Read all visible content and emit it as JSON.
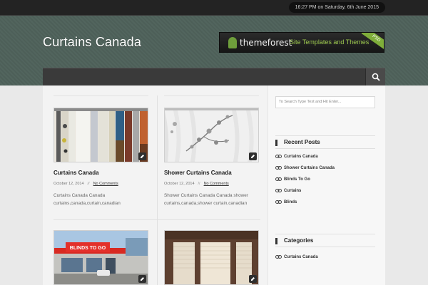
{
  "topbar": {
    "datetime": "16:27 PM on Saturday, 6th June 2015"
  },
  "header": {
    "site_title": "Curtains Canada",
    "banner": {
      "logo": "themeforest",
      "tagline": "Site Templates and Themes",
      "ribbon": "PSD"
    }
  },
  "nav": {
    "search_icon": "search-icon"
  },
  "posts": [
    {
      "title": "Curtains Canada",
      "date": "October 12, 2014",
      "separator": "//",
      "comments": "No Comments",
      "excerpt": "Curtains Canada Canada curtains,canada,curtain,canadian"
    },
    {
      "title": "Shower Curtains Canada",
      "date": "October 12, 2014",
      "separator": "//",
      "comments": "No Comments",
      "excerpt": "Shower Curtains Canada Canada shower curtains,canada,shower curtain,canadian"
    },
    {
      "thumb_sign": "BLINDS TO GO"
    },
    {}
  ],
  "sidebar": {
    "search_placeholder": "To Search Type Text and Hit Enter...",
    "recent_posts": {
      "title": "Recent Posts",
      "items": [
        "Curtains Canada",
        "Shower Curtains Canada",
        "Blinds To Go",
        "Curtains",
        "Blinds"
      ]
    },
    "categories": {
      "title": "Categories",
      "items": [
        "Curtains Canada"
      ]
    }
  },
  "colors": {
    "header_bg": "#4f625b",
    "topbar_bg": "#232323",
    "nav_bg": "#3a3a3a",
    "accent_green": "#7fae3a"
  }
}
